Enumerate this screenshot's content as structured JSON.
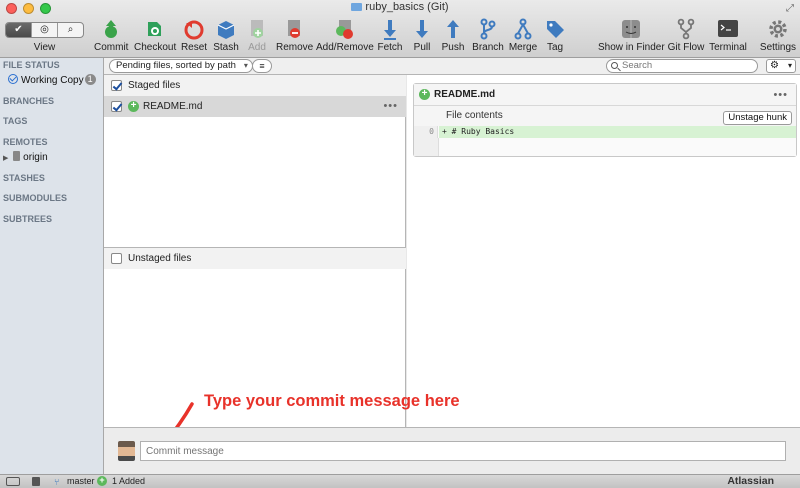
{
  "window": {
    "title": "ruby_basics (Git)"
  },
  "toolbar": {
    "view_label": "View",
    "buttons": [
      {
        "label": "Commit",
        "icon": "commit-icon",
        "color": "#3aa34a"
      },
      {
        "label": "Checkout",
        "icon": "checkout-icon",
        "color": "#2fa05a"
      },
      {
        "label": "Reset",
        "icon": "reset-icon",
        "color": "#e03b2f"
      },
      {
        "label": "Stash",
        "icon": "stash-icon",
        "color": "#3f7bbf"
      },
      {
        "label": "Add",
        "icon": "add-icon",
        "color": "#5cb85c"
      },
      {
        "label": "Remove",
        "icon": "remove-icon",
        "color": "#e03b2f"
      },
      {
        "label": "Add/Remove",
        "icon": "add-remove-icon",
        "color": "#3f7bbf"
      },
      {
        "label": "Fetch",
        "icon": "fetch-icon",
        "color": "#3f7bbf"
      },
      {
        "label": "Pull",
        "icon": "pull-icon",
        "color": "#3f7bbf"
      },
      {
        "label": "Push",
        "icon": "push-icon",
        "color": "#3f7bbf"
      },
      {
        "label": "Branch",
        "icon": "branch-icon",
        "color": "#3f7bbf"
      },
      {
        "label": "Merge",
        "icon": "merge-icon",
        "color": "#3f7bbf"
      },
      {
        "label": "Tag",
        "icon": "tag-icon",
        "color": "#3f7bbf"
      },
      {
        "label": "Show in Finder",
        "icon": "finder-icon",
        "color": "#777777"
      },
      {
        "label": "Git Flow",
        "icon": "git-flow-icon",
        "color": "#777777"
      },
      {
        "label": "Terminal",
        "icon": "terminal-icon",
        "color": "#555555"
      },
      {
        "label": "Settings",
        "icon": "settings-icon",
        "color": "#777777"
      }
    ]
  },
  "sidebar": {
    "file_status_header": "FILE STATUS",
    "working_copy_label": "Working Copy",
    "working_copy_count": "1",
    "branches_header": "BRANCHES",
    "tags_header": "TAGS",
    "remotes_header": "REMOTES",
    "remote_origin": "origin",
    "stashes_header": "STASHES",
    "submodules_header": "SUBMODULES",
    "subtrees_header": "SUBTREES"
  },
  "filter": {
    "pending_label": "Pending files, sorted by path",
    "search_placeholder": "Search"
  },
  "staged": {
    "header": "Staged files",
    "file_name": "README.md"
  },
  "unstaged": {
    "header": "Unstaged files"
  },
  "diff": {
    "file_name": "README.md",
    "section_label": "File contents",
    "unstage_label": "Unstage hunk",
    "line_number": "0",
    "line_text": "+ # Ruby Basics"
  },
  "commit": {
    "placeholder": "Commit message"
  },
  "annotation": {
    "text": "Type your commit message here",
    "color": "#e8322a"
  },
  "status_bar": {
    "branch": "master",
    "summary": "1 Added",
    "brand": "Atlassian"
  }
}
